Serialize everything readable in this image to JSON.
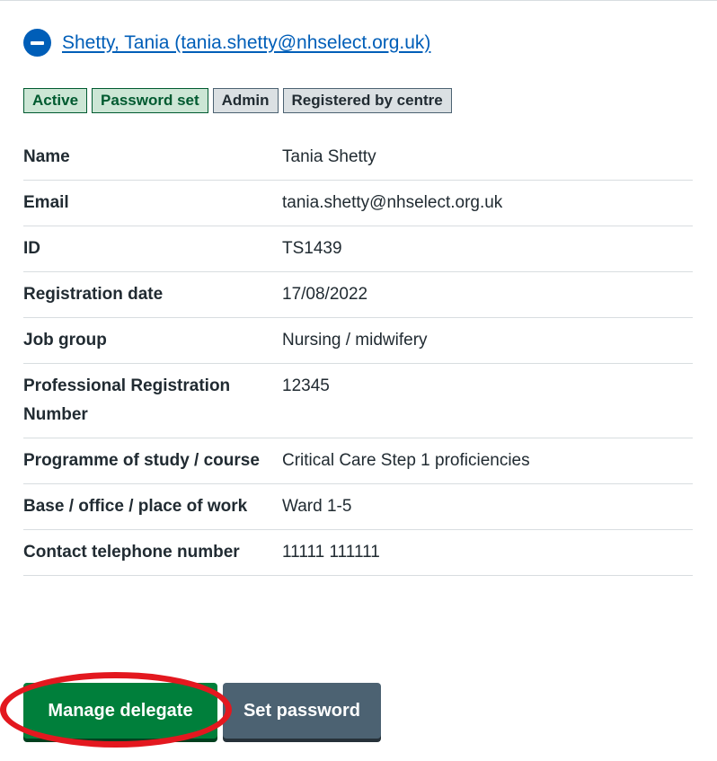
{
  "summary": {
    "link_text": "Shetty, Tania (tania.shetty@nhselect.org.uk)",
    "icon": "minus-circle-icon"
  },
  "tags": [
    "Active",
    "Password set",
    "Admin",
    "Registered by centre"
  ],
  "details": [
    {
      "key": "Name",
      "value": "Tania Shetty"
    },
    {
      "key": "Email",
      "value": "tania.shetty@nhselect.org.uk"
    },
    {
      "key": "ID",
      "value": "TS1439"
    },
    {
      "key": "Registration date",
      "value": "17/08/2022"
    },
    {
      "key": "Job group",
      "value": "Nursing / midwifery"
    },
    {
      "key": "Professional Registration Number",
      "value": "12345"
    },
    {
      "key": "Programme of study / course",
      "value": "Critical Care Step 1 proficiencies"
    },
    {
      "key": "Base / office / place of work",
      "value": "Ward 1-5"
    },
    {
      "key": "Contact telephone number",
      "value": "11111 111111"
    }
  ],
  "buttons": {
    "manage_label": "Manage delegate",
    "set_password_label": "Set password"
  },
  "colors": {
    "link": "#005eb8",
    "primary_button": "#007f3b",
    "secondary_button": "#4c6272",
    "highlight": "#e3181f"
  }
}
